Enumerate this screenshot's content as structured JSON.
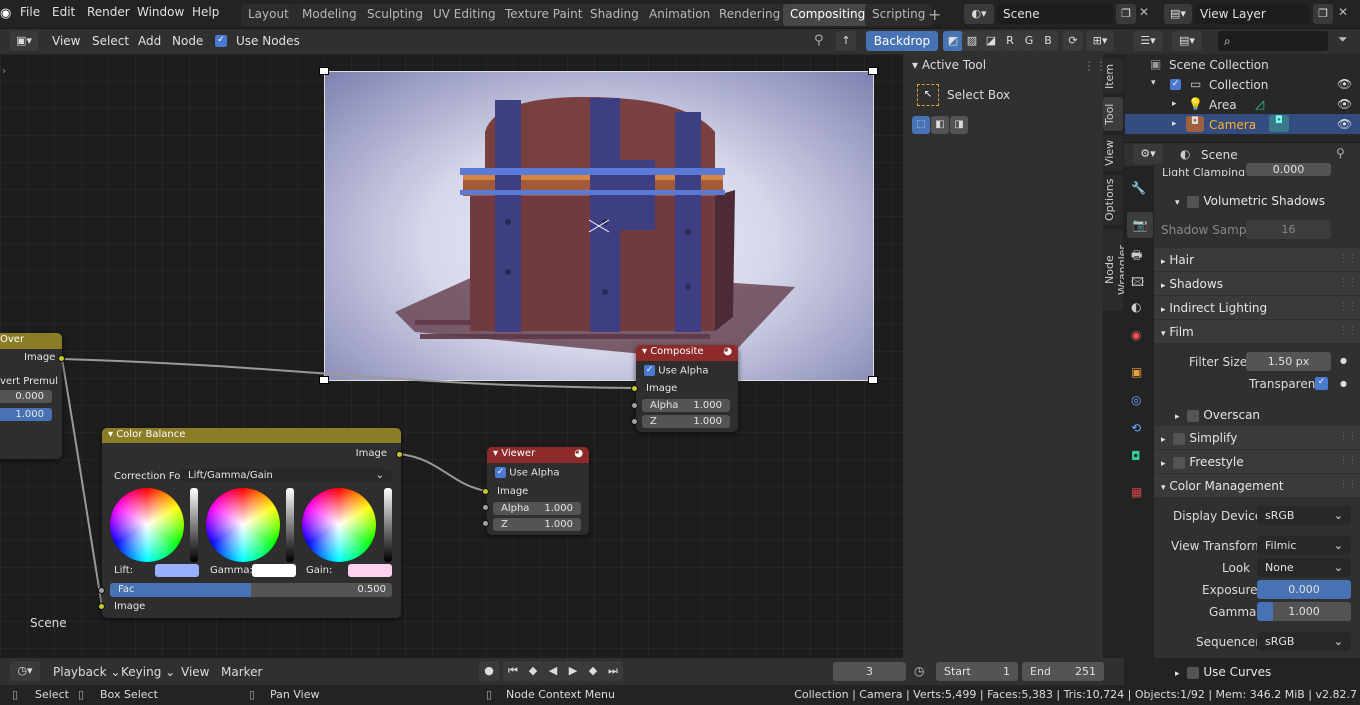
{
  "topbar": {
    "menus": [
      "File",
      "Edit",
      "Render",
      "Window",
      "Help"
    ],
    "workspaces": [
      "Layout",
      "Modeling",
      "Sculpting",
      "UV Editing",
      "Texture Paint",
      "Shading",
      "Animation",
      "Rendering",
      "Compositing",
      "Scripting"
    ],
    "active_workspace": "Compositing",
    "scene": "Scene",
    "view_layer": "View Layer"
  },
  "header": {
    "menus": [
      "View",
      "Select",
      "Add",
      "Node"
    ],
    "use_nodes": "Use Nodes",
    "backdrop": "Backdrop",
    "channels": [
      "R",
      "G",
      "B"
    ]
  },
  "nodes": {
    "alphaover": {
      "title": "Over",
      "image": "Image",
      "premul": "vert Premul",
      "v1": "0.000",
      "v2": "1.000"
    },
    "colorbalance": {
      "title": "Color Balance",
      "image_out": "Image",
      "correction_label": "Correction For..",
      "correction_value": "Lift/Gamma/Gain",
      "lift": "Lift:",
      "gamma": "Gamma:",
      "gain": "Gain:",
      "fac_label": "Fac",
      "fac_value": "0.500",
      "fac": 0.5,
      "image_in": "Image"
    },
    "composite": {
      "title": "Composite",
      "use_alpha": "Use Alpha",
      "image": "Image",
      "alpha_label": "Alpha",
      "alpha": "1.000",
      "z_label": "Z",
      "z": "1.000"
    },
    "viewer": {
      "title": "Viewer",
      "use_alpha": "Use Alpha",
      "image": "Image",
      "alpha_label": "Alpha",
      "alpha": "1.000",
      "z_label": "Z",
      "z": "1.000"
    }
  },
  "editor_label": "Scene",
  "tool_panel": {
    "title": "Active Tool",
    "tool": "Select Box"
  },
  "vertical_tabs": [
    "Item",
    "Tool",
    "View",
    "Options",
    "Node Wrangler"
  ],
  "outliner": {
    "root": "Scene Collection",
    "items": [
      "Collection",
      "Area",
      "Camera"
    ]
  },
  "properties": {
    "context": "Scene",
    "light_clamping_label": "Light Clamping",
    "light_clamping": "0.000",
    "volumetric_shadows": "Volumetric Shadows",
    "shadow_samples_label": "Shadow Samp..",
    "shadow_samples": "16",
    "sections": [
      "Hair",
      "Shadows",
      "Indirect Lighting",
      "Film"
    ],
    "filter_size_label": "Filter Size",
    "filter_size": "1.50 px",
    "transparent": "Transparent",
    "overscan": "Overscan",
    "simplify": "Simplify",
    "freestyle": "Freestyle",
    "color_management": "Color Management",
    "display_device_label": "Display Device",
    "display_device": "sRGB",
    "view_transform_label": "View Transform",
    "view_transform": "Filmic",
    "look_label": "Look",
    "look": "None",
    "exposure_label": "Exposure",
    "exposure": "0.000",
    "gamma_label": "Gamma",
    "gamma": "1.000",
    "sequencer_label": "Sequencer",
    "sequencer": "sRGB",
    "use_curves": "Use Curves"
  },
  "timeline": {
    "menus": [
      "Playback",
      "Keying",
      "View",
      "Marker"
    ],
    "frame": "3",
    "start_label": "Start",
    "start": "1",
    "end_label": "End",
    "end": "251"
  },
  "status": {
    "select": "Select",
    "box_select": "Box Select",
    "pan": "Pan View",
    "context": "Node Context Menu",
    "stats": "Collection | Camera | Verts:5,499 | Faces:5,383 | Tris:10,724 | Objects:1/92 | Mem: 346.2 MiB | v2.82.7"
  },
  "colors": {
    "accent": "#4772b3",
    "node_header_yellow": "#8b7d26",
    "node_header_red": "#8e2a2a",
    "socket": "#c7c729"
  }
}
